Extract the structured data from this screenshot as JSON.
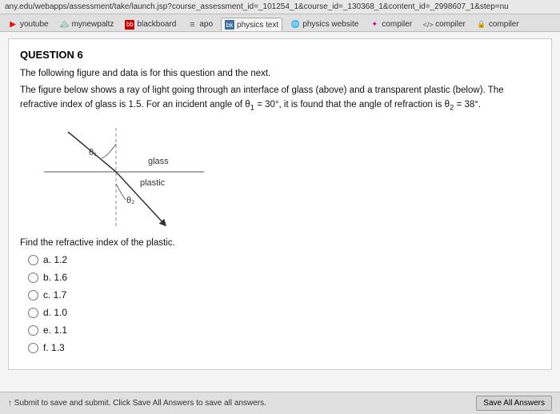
{
  "browser": {
    "url": "any.edu/webapps/assessment/take/launch.jsp?course_assessment_id=_101254_1&course_id=_130368_1&content_id=_2998607_1&step=nu"
  },
  "tabs": [
    {
      "id": "youtube",
      "label": "youtube",
      "icon": "yt",
      "active": false
    },
    {
      "id": "mynewpaltz",
      "label": "mynewpaltz",
      "icon": "feather",
      "active": false
    },
    {
      "id": "blackboard",
      "label": "blackboard",
      "icon": "bb",
      "active": false
    },
    {
      "id": "apo",
      "label": "apo",
      "icon": "menu",
      "active": false
    },
    {
      "id": "physics-text",
      "label": "physics text",
      "icon": "phy",
      "active": true
    },
    {
      "id": "physics-website",
      "label": "physics website",
      "icon": "globe",
      "active": false
    },
    {
      "id": "compiler1",
      "label": "compiler",
      "icon": "compile",
      "active": false
    },
    {
      "id": "compiler2",
      "label": "compiler",
      "icon": "compile-bracket",
      "active": false
    },
    {
      "id": "compiler3",
      "label": "compiler",
      "icon": "compile-lock",
      "active": false
    }
  ],
  "question": {
    "number": "QUESTION 6",
    "intro_line1": "The following figure and data is for this question and the next.",
    "intro_line2": "The figure below shows a ray of light going through an interface of glass (above) and a transparent plastic (below). The refractive index of glass is 1.5. For an incident angle of θ₁ = 30°, it is found that the angle of refraction is θ₂ = 38°.",
    "diagram_labels": {
      "glass": "glass",
      "plastic": "plastic",
      "theta1": "θ₁",
      "theta2": "θ₂"
    },
    "find_text": "Find the refractive index of the plastic.",
    "choices": [
      {
        "id": "a",
        "label": "a.",
        "value": "1.2"
      },
      {
        "id": "b",
        "label": "b.",
        "value": "1.6"
      },
      {
        "id": "c",
        "label": "c.",
        "value": "1.7"
      },
      {
        "id": "d",
        "label": "d.",
        "value": "1.0"
      },
      {
        "id": "e",
        "label": "e.",
        "value": "1.1"
      },
      {
        "id": "f",
        "label": "f.",
        "value": "1.3"
      }
    ]
  },
  "bottom": {
    "submit_hint": "↑ Submit to save and submit. Click Save All Answers to save all answers.",
    "save_all_label": "Save All Answers"
  }
}
